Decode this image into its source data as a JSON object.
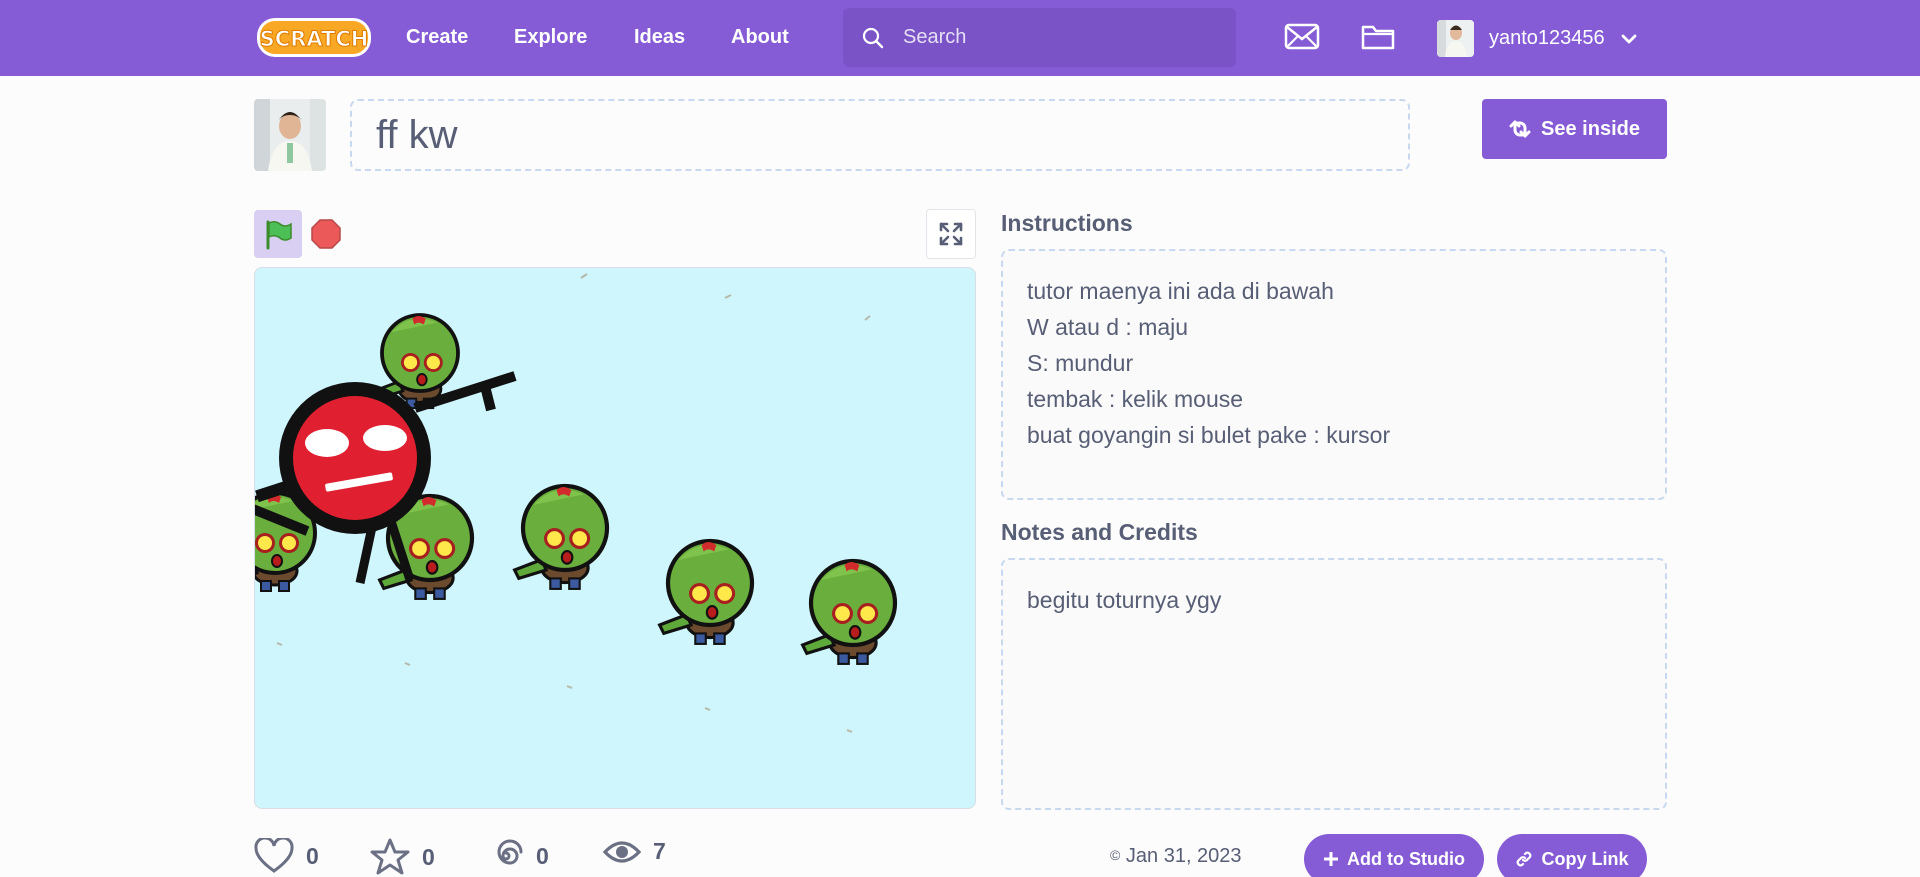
{
  "nav": {
    "logo_text": "SCRATCH",
    "links": [
      "Create",
      "Explore",
      "Ideas",
      "About"
    ],
    "search_placeholder": "Search",
    "username": "yanto123456"
  },
  "project": {
    "title": "ff kw",
    "see_inside_label": "See inside"
  },
  "instructions": {
    "heading": "Instructions",
    "lines": [
      "tutor maenya ini ada di bawah",
      "W atau d : maju",
      "S: mundur",
      "tembak : kelik mouse",
      "buat goyangin si bulet pake : kursor"
    ]
  },
  "notes": {
    "heading": "Notes and Credits",
    "text": "begitu toturnya ygy"
  },
  "stats": {
    "loves": "0",
    "favorites": "0",
    "remixes": "0",
    "views": "7"
  },
  "date": "Jan 31, 2023",
  "date_icon": "©",
  "actions": {
    "add_to_studio": "Add to Studio",
    "copy_link": "Copy Link"
  },
  "colors": {
    "brand": "#855cd6",
    "stage_bg": "#cff5fd"
  }
}
